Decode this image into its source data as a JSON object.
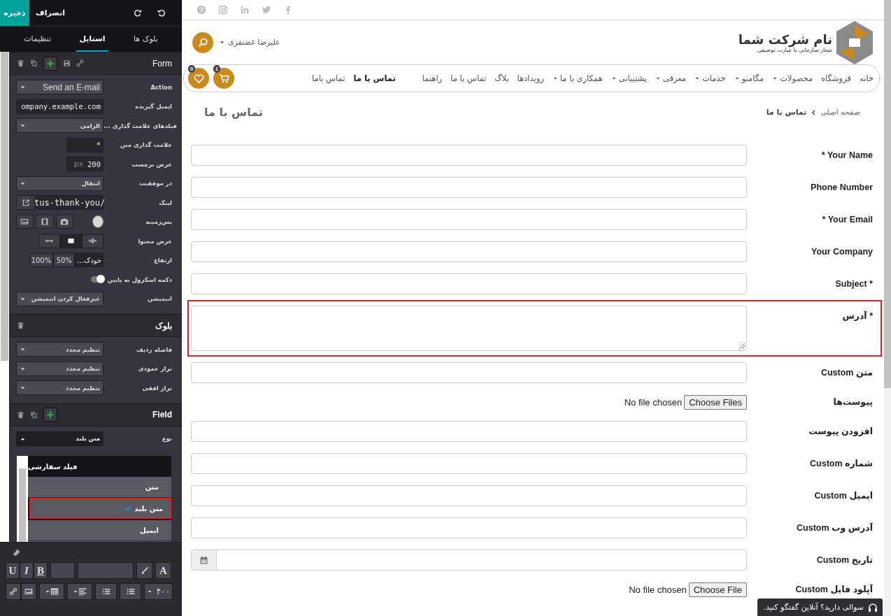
{
  "editor": {
    "save": "ذخیره",
    "discard": "انصراف",
    "tabs": [
      {
        "label": "بلوک ها",
        "selected": false
      },
      {
        "label": "استایل",
        "selected": true
      },
      {
        "label": "تنظیمات",
        "selected": false
      }
    ],
    "sections": [
      {
        "kind": "form",
        "title": "Form",
        "options": [
          {
            "kind": "select",
            "label": "Action",
            "value": "Send an E-mail",
            "expanded": false
          },
          {
            "kind": "input",
            "label": "ایمیل گیرنده",
            "value": "ompany.example.com"
          },
          {
            "kind": "select",
            "label": "فیلدهای علامت گذاری ...",
            "value": "الزامی",
            "expanded": false
          },
          {
            "kind": "short",
            "label": "علامت گذاری متن",
            "value": "*"
          },
          {
            "kind": "unit",
            "label": "عرض برچسب",
            "value": "200",
            "unit": "px"
          },
          {
            "kind": "select",
            "label": "در موفقیت",
            "value": "انتقال",
            "expanded": false
          },
          {
            "kind": "link",
            "label": "لینک",
            "value": "tus-thank-you/"
          },
          {
            "kind": "background",
            "label": "پس‌زمینه"
          },
          {
            "kind": "icons",
            "label": "عرض محتوا",
            "choices": [
              {
                "selected": false
              },
              {
                "selected": true
              },
              {
                "selected": false
              }
            ]
          },
          {
            "kind": "texts",
            "label": "ارتفاع",
            "choices": [
              {
                "text": "خودک…",
                "selected": true
              },
              {
                "text": "50%",
                "selected": false
              },
              {
                "text": "100%",
                "selected": false
              }
            ]
          },
          {
            "kind": "toggle",
            "label": "دکمه اسکرول به پایین",
            "on": true
          },
          {
            "kind": "select",
            "label": "انیمیشن",
            "value": "غیرفعال کردن انیمیشن",
            "expanded": false
          }
        ]
      },
      {
        "kind": "row",
        "title": "بلوک",
        "options": [
          {
            "kind": "select",
            "label": "فاصله ردیف",
            "value": "تنظیم مجدد",
            "expanded": false
          },
          {
            "kind": "select",
            "label": "تراز عمودی",
            "value": "تنظیم مجدد",
            "expanded": false
          },
          {
            "kind": "select",
            "label": "تراز افقی",
            "value": "تنظیم مجدد",
            "expanded": false
          }
        ]
      },
      {
        "kind": "field",
        "title": "Field",
        "options": [
          {
            "kind": "select",
            "label": "نوع",
            "value": "متن بلند",
            "expanded": true
          }
        ]
      }
    ],
    "type_menu": {
      "header": "فیلد سفارشی",
      "items": [
        {
          "label": "متن",
          "selected": false
        },
        {
          "label": "متن بلند",
          "selected": true
        },
        {
          "label": "ایمیل",
          "selected": false
        }
      ]
    },
    "toolbar": {
      "styles": [
        "B",
        "I",
        "U"
      ],
      "text_color": "A",
      "font_size": "۴۰۰"
    }
  },
  "site": {
    "company_name": "نام شرکت شما",
    "tagline": "شعار سازمانی یا عبارت توصیفی",
    "user": "علیرضا غضنفری",
    "menu": [
      {
        "label": "خانه",
        "dropdown": false
      },
      {
        "label": "فروشگاه",
        "dropdown": false
      },
      {
        "label": "محصولات",
        "dropdown": true
      },
      {
        "label": "مگامنو",
        "dropdown": true
      },
      {
        "label": "خدمات",
        "dropdown": true
      },
      {
        "label": "معرفی",
        "dropdown": true
      },
      {
        "label": "پشتیبانی",
        "dropdown": true
      },
      {
        "label": "همکاری با ما",
        "dropdown": true
      },
      {
        "label": "رویدادها",
        "dropdown": false
      },
      {
        "label": "بلاگ",
        "dropdown": false
      },
      {
        "label": "تماس با ما",
        "dropdown": false
      },
      {
        "label": "راهنما",
        "dropdown": false
      }
    ],
    "menu_extra": [
      {
        "label": "تماس با ما",
        "selected": true
      },
      {
        "label": "تماس باما",
        "selected": false
      }
    ],
    "cart_count": "1",
    "wishlist_count": "0",
    "breadcrumb": [
      "صفحه اصلی",
      "تماس با ما"
    ],
    "page_title": "تماس با ما",
    "fields": [
      {
        "kind": "text",
        "label": "* Your Name",
        "selected": false
      },
      {
        "kind": "text",
        "label": "Phone Number",
        "selected": false
      },
      {
        "kind": "text",
        "label": "* Your Email",
        "selected": false
      },
      {
        "kind": "text",
        "label": "Your Company",
        "selected": false
      },
      {
        "kind": "text",
        "label": "Subject *",
        "selected": false
      },
      {
        "kind": "textarea",
        "label": "آدرس *",
        "selected": true
      },
      {
        "kind": "text",
        "label": "Custom متن",
        "selected": false
      },
      {
        "kind": "file",
        "label": "پیوست‌ها",
        "button": "Choose Files",
        "status": "No file chosen",
        "selected": false
      },
      {
        "kind": "text",
        "label": "افزودن پیوست",
        "selected": false
      },
      {
        "kind": "text",
        "label": "Custom شماره",
        "selected": false
      },
      {
        "kind": "text",
        "label": "Custom ایمیل",
        "selected": false
      },
      {
        "kind": "text",
        "label": "Custom آدرس وب",
        "selected": false
      },
      {
        "kind": "date",
        "label": "Custom تاریخ",
        "selected": false
      },
      {
        "kind": "file",
        "label": "Custom آپلود فایل",
        "button": "Choose File",
        "status": "No file chosen",
        "selected": false
      }
    ],
    "chat": "سوالی دارید؟ آنلاین گفتگو کنید."
  }
}
